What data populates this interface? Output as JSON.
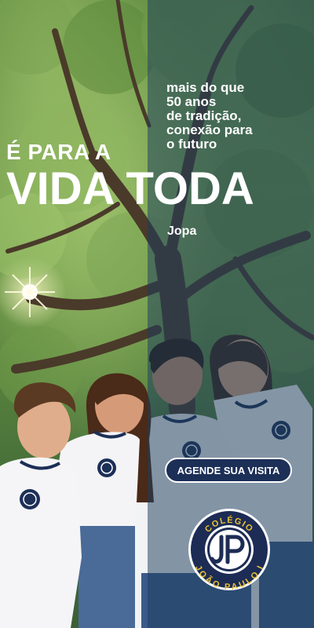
{
  "banner": {
    "tagline": "mais do que\n50 anos\nde tradição,\nconexão para\no futuro",
    "headline_small": "É PARA A",
    "headline_big": "VIDA TODA",
    "brand_short": "Jopa",
    "cta_label": "AGENDE SUA VISITA",
    "logo": {
      "text_top": "COLÉGIO",
      "text_bottom": "JOÃO PAULO I",
      "monogram": "JP"
    }
  },
  "colors": {
    "panel": "#1c3e5c",
    "navy": "#1c2f57",
    "logo_ring": "#1d2c55",
    "logo_accent": "#e8c233",
    "text": "#ffffff"
  },
  "icons": [
    "sun-flare-icon",
    "school-crest-icon"
  ]
}
